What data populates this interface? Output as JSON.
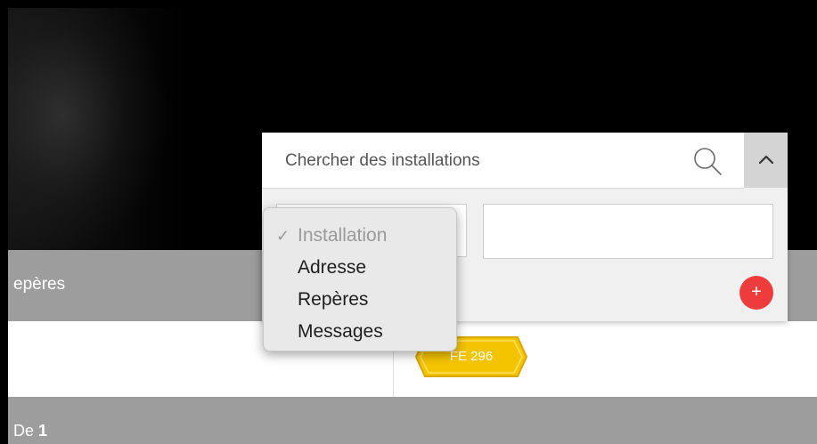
{
  "search": {
    "placeholder": "Chercher des installations",
    "value": ""
  },
  "filter": {
    "options": [
      {
        "label": "Installation",
        "selected": true
      },
      {
        "label": "Adresse",
        "selected": false
      },
      {
        "label": "Repères",
        "selected": false
      },
      {
        "label": "Messages",
        "selected": false
      }
    ],
    "check_glyph": "✓",
    "value_input": ""
  },
  "actions": {
    "add_glyph": "+"
  },
  "table": {
    "header_label": "epères",
    "tag_label": "FE 296"
  },
  "pagination": {
    "prefix": "De",
    "total": "1"
  },
  "colors": {
    "accent_red": "#ee3b3b",
    "tag_yellow": "#f5c400",
    "band_gray": "#9d9d9d"
  }
}
